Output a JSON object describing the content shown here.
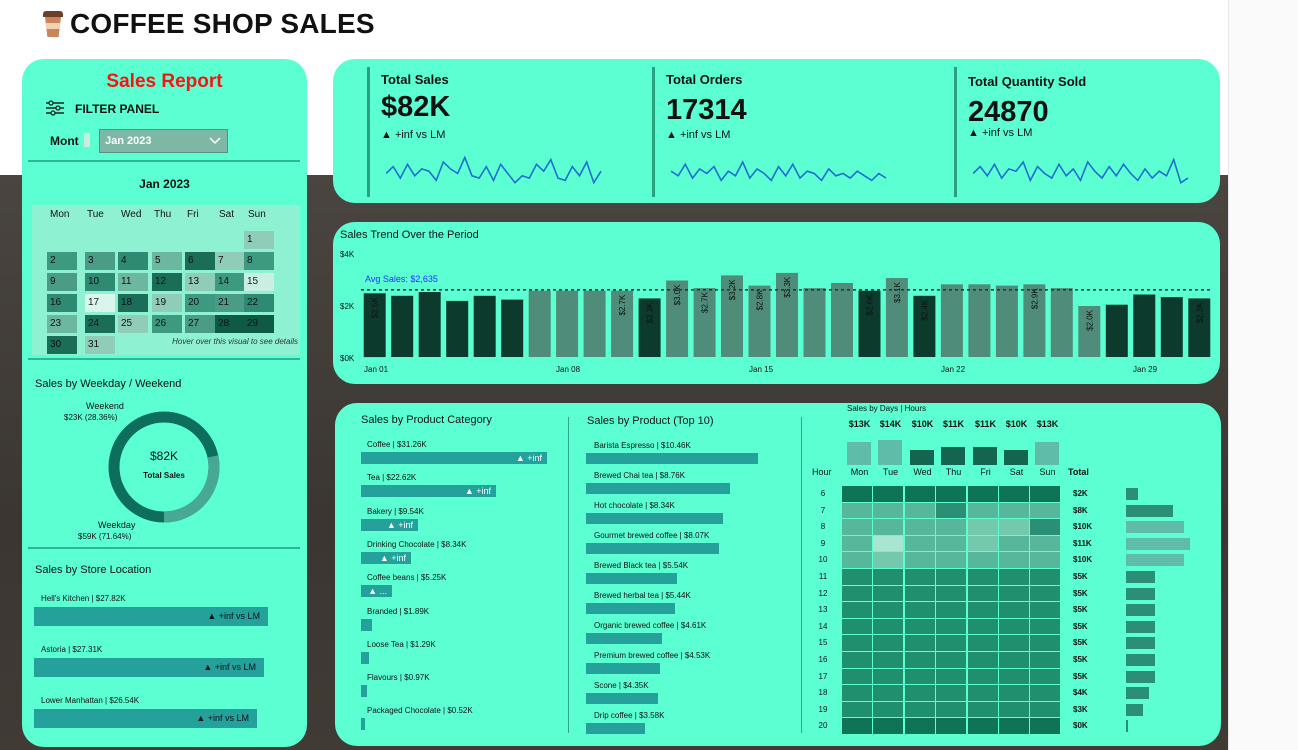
{
  "app": {
    "title": "COFFEE SHOP SALES"
  },
  "colors": {
    "panel": "#5cffd1",
    "bar": "#23a19a",
    "dark": "#0b3a2c",
    "accent_red": "#ff1010"
  },
  "left": {
    "report_title": "Sales Report",
    "filter_label": "FILTER PANEL",
    "month_label": "Mont",
    "month_value": "Jan 2023",
    "calendar": {
      "title": "Jan 2023",
      "days": [
        "Mon",
        "Tue",
        "Wed",
        "Thu",
        "Fri",
        "Sat",
        "Sun"
      ],
      "hint": "Hover over this visual to see details",
      "dates": [
        "1",
        "2",
        "3",
        "4",
        "5",
        "6",
        "7",
        "8",
        "9",
        "10",
        "11",
        "12",
        "13",
        "14",
        "15",
        "16",
        "17",
        "18",
        "19",
        "20",
        "21",
        "22",
        "23",
        "24",
        "25",
        "26",
        "27",
        "28",
        "29",
        "30",
        "31"
      ]
    },
    "weekday": {
      "title": "Sales by Weekday / Weekend",
      "weekend_label": "Weekend",
      "weekend_value": "$23K (28.36%)",
      "center_value": "$82K",
      "center_label": "Total Sales",
      "weekday_label": "Weekday",
      "weekday_value": "$59K (71.64%)",
      "weekend_share": 28.36
    },
    "store": {
      "title": "Sales by Store Location",
      "items": [
        {
          "label": "Hell's Kitchen | $27.82K",
          "badge": "▲ +inf vs LM",
          "value": 27.82
        },
        {
          "label": "Astoria | $27.31K",
          "badge": "▲ +inf vs LM",
          "value": 27.31
        },
        {
          "label": "Lower Manhattan | $26.54K",
          "badge": "▲ +inf vs LM",
          "value": 26.54
        }
      ]
    }
  },
  "kpis": [
    {
      "title": "Total Sales",
      "value": "$82K",
      "delta": "▲ +inf vs LM"
    },
    {
      "title": "Total Orders",
      "value": "17314",
      "delta": "▲ +inf vs LM"
    },
    {
      "title": "Total Quantity Sold",
      "value": "24870",
      "delta": "▲ +inf vs LM"
    }
  ],
  "trend": {
    "title": "Sales Trend Over the Period",
    "avg_label": "Avg Sales: $2,635",
    "y_ticks": [
      "$4K",
      "$2K",
      "$0K"
    ],
    "x_ticks": [
      "Jan 01",
      "Jan 08",
      "Jan 15",
      "Jan 22",
      "Jan 29"
    ]
  },
  "category": {
    "title": "Sales by Product Category",
    "items": [
      {
        "label": "Coffee | $31.26K",
        "value": 31.26,
        "badge": "▲ +inf"
      },
      {
        "label": "Tea | $22.62K",
        "value": 22.62,
        "badge": "▲ +inf"
      },
      {
        "label": "Bakery | $9.54K",
        "value": 9.54,
        "badge": "▲ +inf"
      },
      {
        "label": "Drinking Chocolate | $8.34K",
        "value": 8.34,
        "badge": "▲ +inf"
      },
      {
        "label": "Coffee beans | $5.25K",
        "value": 5.25,
        "badge": "▲ ..."
      },
      {
        "label": "Branded | $1.89K",
        "value": 1.89,
        "badge": ""
      },
      {
        "label": "Loose Tea | $1.29K",
        "value": 1.29,
        "badge": ""
      },
      {
        "label": "Flavours | $0.97K",
        "value": 0.97,
        "badge": ""
      },
      {
        "label": "Packaged Chocolate | $0.52K",
        "value": 0.52,
        "badge": ""
      }
    ]
  },
  "products": {
    "title": "Sales by Product (Top 10)",
    "items": [
      {
        "label": "Barista Espresso | $10.46K",
        "value": 10.46
      },
      {
        "label": "Brewed Chai tea | $8.76K",
        "value": 8.76
      },
      {
        "label": "Hot chocolate | $8.34K",
        "value": 8.34
      },
      {
        "label": "Gourmet brewed coffee | $8.07K",
        "value": 8.07
      },
      {
        "label": "Brewed Black tea | $5.54K",
        "value": 5.54
      },
      {
        "label": "Brewed herbal tea | $5.44K",
        "value": 5.44
      },
      {
        "label": "Organic brewed coffee | $4.61K",
        "value": 4.61
      },
      {
        "label": "Premium brewed coffee | $4.53K",
        "value": 4.53
      },
      {
        "label": "Scone | $4.35K",
        "value": 4.35
      },
      {
        "label": "Drip coffee | $3.58K",
        "value": 3.58
      }
    ]
  },
  "heatmap": {
    "title": "Sales by Days | Hours",
    "day_totals": [
      "$13K",
      "$14K",
      "$10K",
      "$11K",
      "$11K",
      "$10K",
      "$13K"
    ],
    "day_values": [
      13,
      14,
      10,
      11,
      11,
      10,
      13
    ],
    "days": [
      "Mon",
      "Tue",
      "Wed",
      "Thu",
      "Fri",
      "Sat",
      "Sun"
    ],
    "hour_header": "Hour",
    "total_header": "Total",
    "hours": [
      "6",
      "7",
      "8",
      "9",
      "10",
      "11",
      "12",
      "13",
      "14",
      "15",
      "16",
      "17",
      "18",
      "19",
      "20"
    ],
    "hour_totals": [
      "$2K",
      "$8K",
      "$10K",
      "$11K",
      "$10K",
      "$5K",
      "$5K",
      "$5K",
      "$5K",
      "$5K",
      "$5K",
      "$5K",
      "$4K",
      "$3K",
      "$0K"
    ],
    "hour_values": [
      2,
      8,
      10,
      11,
      10,
      5,
      5,
      5,
      5,
      5,
      5,
      5,
      4,
      3,
      0
    ]
  },
  "chart_data": {
    "type": "bar",
    "title": "Sales Trend Over the Period",
    "categories": [
      "Jan 01",
      "Jan 02",
      "Jan 03",
      "Jan 04",
      "Jan 05",
      "Jan 06",
      "Jan 07",
      "Jan 08",
      "Jan 09",
      "Jan 10",
      "Jan 11",
      "Jan 12",
      "Jan 13",
      "Jan 14",
      "Jan 15",
      "Jan 16",
      "Jan 17",
      "Jan 18",
      "Jan 19",
      "Jan 20",
      "Jan 21",
      "Jan 22",
      "Jan 23",
      "Jan 24",
      "Jan 25",
      "Jan 26",
      "Jan 27",
      "Jan 28",
      "Jan 29",
      "Jan 30",
      "Jan 31"
    ],
    "values": [
      2.5,
      2.4,
      2.55,
      2.2,
      2.4,
      2.25,
      2.6,
      2.6,
      2.6,
      2.6,
      2.3,
      3.0,
      2.7,
      3.2,
      2.8,
      3.3,
      2.7,
      2.9,
      2.6,
      3.1,
      2.4,
      2.85,
      2.85,
      2.8,
      2.85,
      2.7,
      2.0,
      2.05,
      2.45,
      2.35,
      2.3
    ],
    "value_labels": [
      "$2.5K",
      "",
      "",
      "",
      "",
      "",
      "",
      "",
      "",
      "$2.7K",
      "$2.3K",
      "$3.0K",
      "$2.7K",
      "$3.2K",
      "$2.8K",
      "$3.3K",
      "",
      "",
      "$2.6K",
      "$3.1K",
      "$2.4K",
      "",
      "",
      "",
      "$2.9K",
      "",
      "$2.0K",
      "",
      "",
      "",
      "$2.3K"
    ],
    "average": 2.635,
    "ylim": [
      0,
      4
    ],
    "ylabel": "",
    "xlabel": ""
  }
}
